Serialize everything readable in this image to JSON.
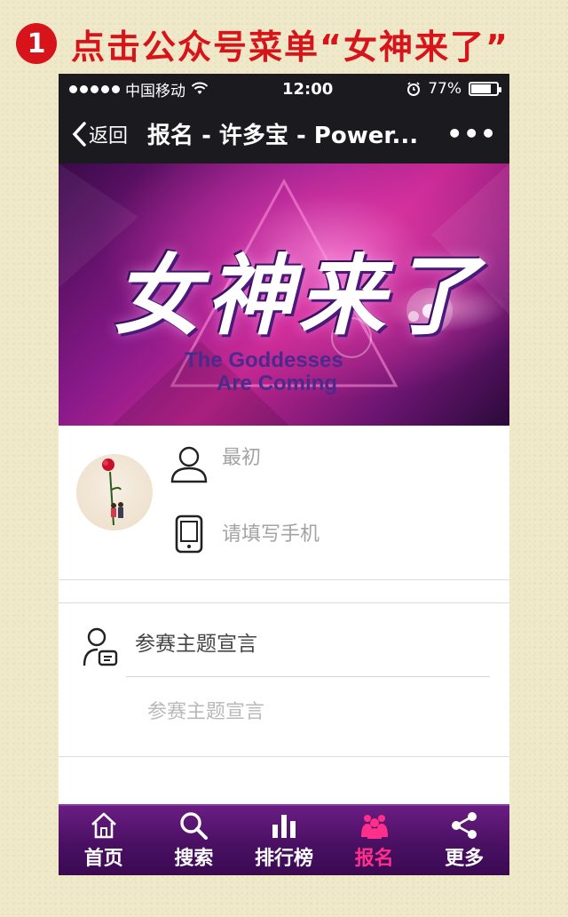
{
  "step": {
    "number": "1",
    "text": "点击公众号菜单“女神来了”"
  },
  "status_bar": {
    "carrier": "中国移动",
    "time": "12:00",
    "battery": "77%",
    "battery_level": 0.77
  },
  "nav": {
    "back_label": "返回",
    "title": "报名 - 许多宝 - Power...",
    "more_label": "•••"
  },
  "banner": {
    "title": "女神来了",
    "subtitle_line1": "The Goddesses",
    "subtitle_line2": "Are Coming"
  },
  "form": {
    "name_value": "最初",
    "phone_placeholder": "请填写手机",
    "declaration_label": "参赛主题宣言",
    "declaration_placeholder": "参赛主题宣言"
  },
  "tabbar": {
    "items": [
      {
        "label": "首页",
        "icon": "home-icon"
      },
      {
        "label": "搜索",
        "icon": "search-icon"
      },
      {
        "label": "排行榜",
        "icon": "ranking-icon"
      },
      {
        "label": "报名",
        "icon": "signup-icon"
      },
      {
        "label": "更多",
        "icon": "share-icon"
      }
    ],
    "active_index": 3
  },
  "colors": {
    "accent_red": "#d8141b",
    "tab_active": "#ff2f8a",
    "tab_bg": "#4a1063"
  }
}
